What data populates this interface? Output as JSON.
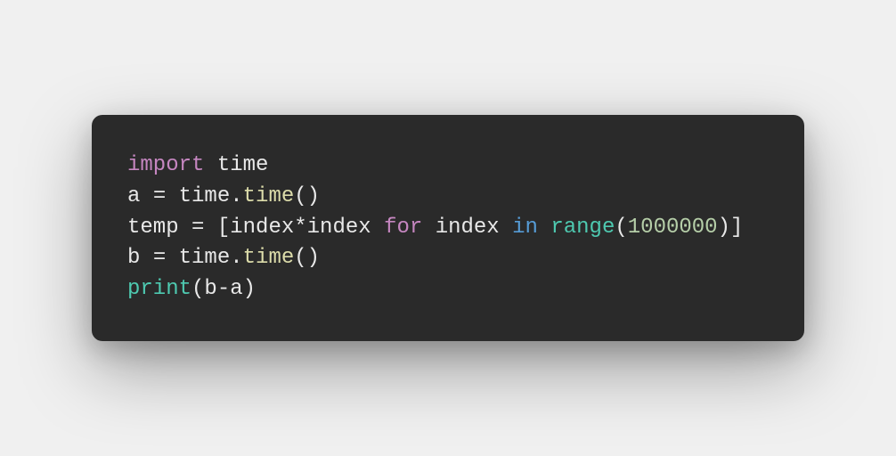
{
  "code": {
    "lines": [
      {
        "tokens": [
          {
            "cls": "kw-import",
            "text": "import"
          },
          {
            "cls": "ident",
            "text": " time"
          }
        ]
      },
      {
        "tokens": [
          {
            "cls": "ident",
            "text": "a "
          },
          {
            "cls": "op",
            "text": "="
          },
          {
            "cls": "ident",
            "text": " time"
          },
          {
            "cls": "punct",
            "text": "."
          },
          {
            "cls": "func",
            "text": "time"
          },
          {
            "cls": "punct",
            "text": "()"
          }
        ]
      },
      {
        "tokens": [
          {
            "cls": "ident",
            "text": "temp "
          },
          {
            "cls": "op",
            "text": "="
          },
          {
            "cls": "punct",
            "text": " ["
          },
          {
            "cls": "ident",
            "text": "index"
          },
          {
            "cls": "op",
            "text": "*"
          },
          {
            "cls": "ident",
            "text": "index "
          },
          {
            "cls": "kw-for",
            "text": "for"
          },
          {
            "cls": "ident",
            "text": " index "
          },
          {
            "cls": "kw-in",
            "text": "in"
          },
          {
            "cls": "ident",
            "text": " "
          },
          {
            "cls": "builtin",
            "text": "range"
          },
          {
            "cls": "punct",
            "text": "("
          },
          {
            "cls": "num",
            "text": "1000000"
          },
          {
            "cls": "punct",
            "text": ")]"
          }
        ]
      },
      {
        "tokens": [
          {
            "cls": "ident",
            "text": "b "
          },
          {
            "cls": "op",
            "text": "="
          },
          {
            "cls": "ident",
            "text": " time"
          },
          {
            "cls": "punct",
            "text": "."
          },
          {
            "cls": "func",
            "text": "time"
          },
          {
            "cls": "punct",
            "text": "()"
          }
        ]
      },
      {
        "tokens": [
          {
            "cls": "builtin",
            "text": "print"
          },
          {
            "cls": "punct",
            "text": "("
          },
          {
            "cls": "ident",
            "text": "b"
          },
          {
            "cls": "op",
            "text": "-"
          },
          {
            "cls": "ident",
            "text": "a"
          },
          {
            "cls": "punct",
            "text": ")"
          }
        ]
      }
    ]
  }
}
